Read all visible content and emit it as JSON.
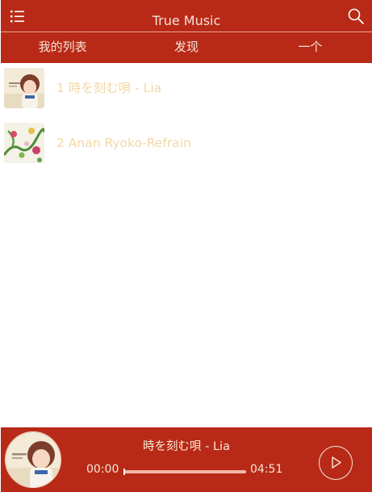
{
  "header": {
    "title": "True Music",
    "menu_icon": "list-menu-icon",
    "search_icon": "search-icon"
  },
  "tabs": [
    {
      "label": "我的列表"
    },
    {
      "label": "发现"
    },
    {
      "label": "一个"
    }
  ],
  "songs": [
    {
      "label": "1 時を刻む唄 - Lia",
      "cover": "anime-girl-cover"
    },
    {
      "label": "2 Anan Ryoko-Refrain",
      "cover": "floral-cover"
    }
  ],
  "player": {
    "title": "時を刻む唄 - Lia",
    "current_time": "00:00",
    "total_time": "04:51",
    "progress": 0,
    "play_icon": "play-icon"
  },
  "colors": {
    "primary": "#b82a17",
    "song_text": "#f3d7a6",
    "light_text": "#f7e6d6"
  }
}
